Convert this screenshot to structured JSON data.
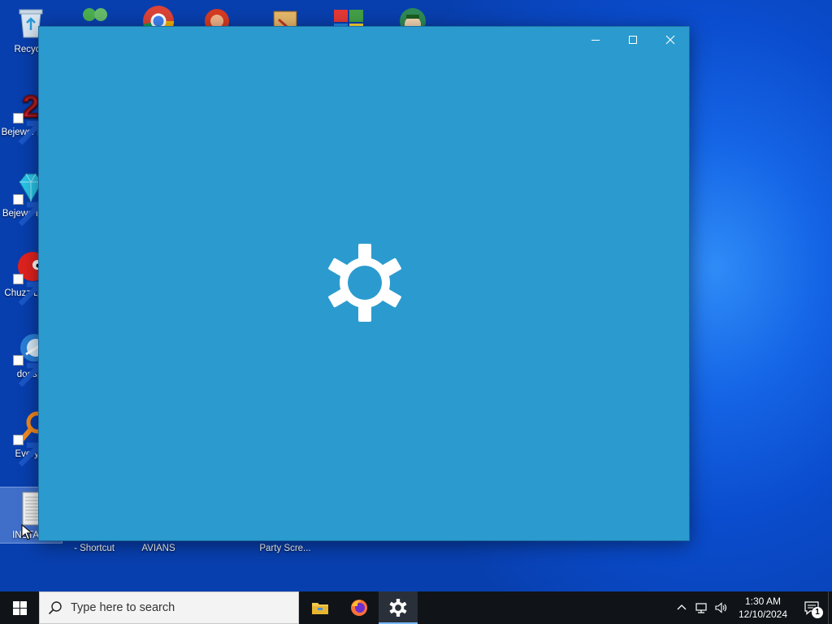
{
  "desktop": {
    "icons_left": [
      {
        "label": "Recycle"
      },
      {
        "label": "Bejewel Delux"
      },
      {
        "label": "Bejewe Delux"
      },
      {
        "label": "Chuzz Delux"
      },
      {
        "label": "doesnt"
      },
      {
        "label": "Everyth"
      },
      {
        "label": "INSTALL"
      }
    ],
    "icons_bottom": [
      {
        "label": "- Shortcut"
      },
      {
        "label": "AVIANS"
      },
      {
        "label": "Party Scre..."
      }
    ]
  },
  "window": {
    "bg_color": "#2b9bcf",
    "splash_icon": "gear-icon"
  },
  "taskbar": {
    "search_placeholder": "Type here to search",
    "apps": [
      {
        "icon": "file-explorer-icon"
      },
      {
        "icon": "firefox-icon"
      },
      {
        "icon": "settings-gear-icon",
        "active": true
      }
    ],
    "clock_time": "1:30 AM",
    "clock_date": "12/10/2024",
    "notification_count": "1"
  }
}
